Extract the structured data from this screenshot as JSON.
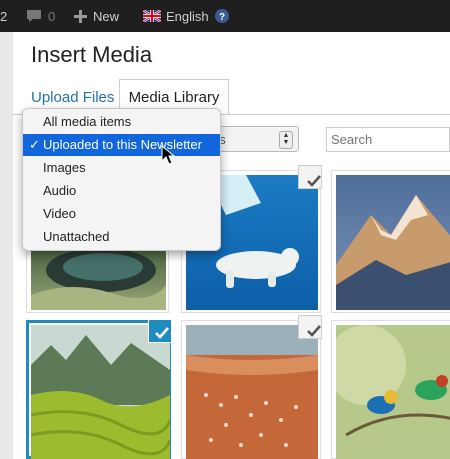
{
  "admin_bar": {
    "number": "2",
    "comments_count": "0",
    "new_label": "New",
    "language_label": "English",
    "icons": [
      "comment-icon",
      "plus-icon",
      "flag-uk-icon",
      "help-icon"
    ]
  },
  "modal": {
    "title": "Insert Media",
    "tabs": [
      {
        "label": "Upload Files",
        "active": false
      },
      {
        "label": "Media Library",
        "active": true
      }
    ]
  },
  "filter": {
    "visible_value_fragment": "es",
    "options": [
      {
        "label": "All media items",
        "selected": false
      },
      {
        "label": "Uploaded to this Newsletter",
        "selected": true
      },
      {
        "label": "Images",
        "selected": false
      },
      {
        "label": "Audio",
        "selected": false
      },
      {
        "label": "Video",
        "selected": false
      },
      {
        "label": "Unattached",
        "selected": false
      }
    ],
    "checkmark": "✓"
  },
  "search": {
    "placeholder": "Search"
  },
  "grid": {
    "items": [
      {
        "subject": "mossy water cave",
        "checked": false
      },
      {
        "subject": "polar bear swimming",
        "checked": true
      },
      {
        "subject": "snowy mountain peak",
        "checked": false
      },
      {
        "subject": "green rice terraces valley",
        "checked": true,
        "selected": true
      },
      {
        "subject": "flamingos on red lake",
        "checked": true
      },
      {
        "subject": "bee-eater birds",
        "checked": false
      }
    ]
  },
  "colors": {
    "accent": "#1e8cbe",
    "link": "#2271b1",
    "highlight": "#1166dd",
    "admin_bar": "#1f1f1f"
  }
}
